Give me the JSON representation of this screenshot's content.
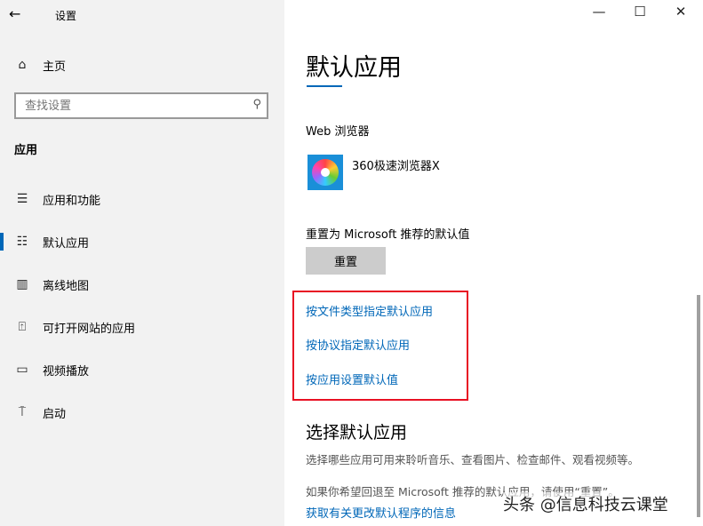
{
  "window": {
    "title": "设置",
    "back": "←",
    "minimize": "—",
    "maximize": "☐",
    "close": "✕"
  },
  "sidebar": {
    "home": "主页",
    "search_placeholder": "查找设置",
    "section": "应用",
    "items": [
      {
        "label": "应用和功能",
        "icon": "apps-features-icon"
      },
      {
        "label": "默认应用",
        "icon": "default-apps-icon",
        "active": true
      },
      {
        "label": "离线地图",
        "icon": "offline-maps-icon"
      },
      {
        "label": "可打开网站的应用",
        "icon": "apps-for-websites-icon"
      },
      {
        "label": "视频播放",
        "icon": "video-playback-icon"
      },
      {
        "label": "启动",
        "icon": "startup-icon"
      }
    ]
  },
  "main": {
    "title": "默认应用",
    "web_browser_label": "Web 浏览器",
    "browser_name": "360极速浏览器X",
    "reset_label": "重置为 Microsoft 推荐的默认值",
    "reset_button": "重置",
    "links": [
      "按文件类型指定默认应用",
      "按协议指定默认应用",
      "按应用设置默认值"
    ],
    "choose_title": "选择默认应用",
    "choose_desc": "选择哪些应用可用来聆听音乐、查看图片、检查邮件、观看视频等。",
    "revert_text": "如果你希望回退至 Microsoft 推荐的默认应用，请使用“重置”。",
    "info_link": "获取有关更改默认程序的信息"
  },
  "watermark": "头条 @信息科技云课堂",
  "colors": {
    "accent": "#0067b8",
    "highlight_box": "#e81123"
  }
}
